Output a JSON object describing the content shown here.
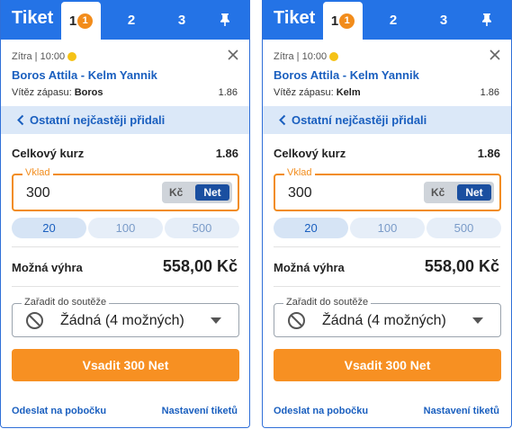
{
  "tickets": [
    {
      "title": "Tiket",
      "tabs": {
        "active": "1",
        "badge": "1",
        "t2": "2",
        "t3": "3"
      },
      "event": {
        "meta": "Zítra | 10:00",
        "name": "Boros Attila - Kelm Yannik",
        "market_label": "Vítěz zápasu:",
        "selection": "Boros",
        "odd": "1.86"
      },
      "popular_label": "Ostatní nejčastěji přidali",
      "total_odds_label": "Celkový kurz",
      "total_odds": "1.86",
      "stake": {
        "legend": "Vklad",
        "value": "300",
        "currency_kc": "Kč",
        "currency_net": "Net"
      },
      "quick_amounts": [
        "20",
        "100",
        "500"
      ],
      "win_label": "Možná výhra",
      "win_value": "558,00 Kč",
      "contest": {
        "legend": "Zařadit do soutěže",
        "value": "Žádná (4 možných)"
      },
      "place_bet": "Vsadit 300 Net",
      "footer": {
        "send_branch": "Odeslat na pobočku",
        "settings": "Nastavení tiketů"
      }
    },
    {
      "title": "Tiket",
      "tabs": {
        "active": "1",
        "badge": "1",
        "t2": "2",
        "t3": "3"
      },
      "event": {
        "meta": "Zítra | 10:00",
        "name": "Boros Attila - Kelm Yannik",
        "market_label": "Vítěz zápasu:",
        "selection": "Kelm",
        "odd": "1.86"
      },
      "popular_label": "Ostatní nejčastěji přidali",
      "total_odds_label": "Celkový kurz",
      "total_odds": "1.86",
      "stake": {
        "legend": "Vklad",
        "value": "300",
        "currency_kc": "Kč",
        "currency_net": "Net"
      },
      "quick_amounts": [
        "20",
        "100",
        "500"
      ],
      "win_label": "Možná výhra",
      "win_value": "558,00 Kč",
      "contest": {
        "legend": "Zařadit do soutěže",
        "value": "Žádná (4 možných)"
      },
      "place_bet": "Vsadit 300 Net",
      "footer": {
        "send_branch": "Odeslat na pobočku",
        "settings": "Nastavení tiketů"
      }
    }
  ],
  "colors": {
    "brand_blue": "#2473e6",
    "link_blue": "#1a5fbf",
    "accent_orange": "#f79022",
    "net_button": "#1a4fa0"
  },
  "icons": [
    "pin-icon",
    "sun-icon",
    "close-icon",
    "chevron-left-icon",
    "no-entry-icon",
    "caret-down-icon"
  ]
}
